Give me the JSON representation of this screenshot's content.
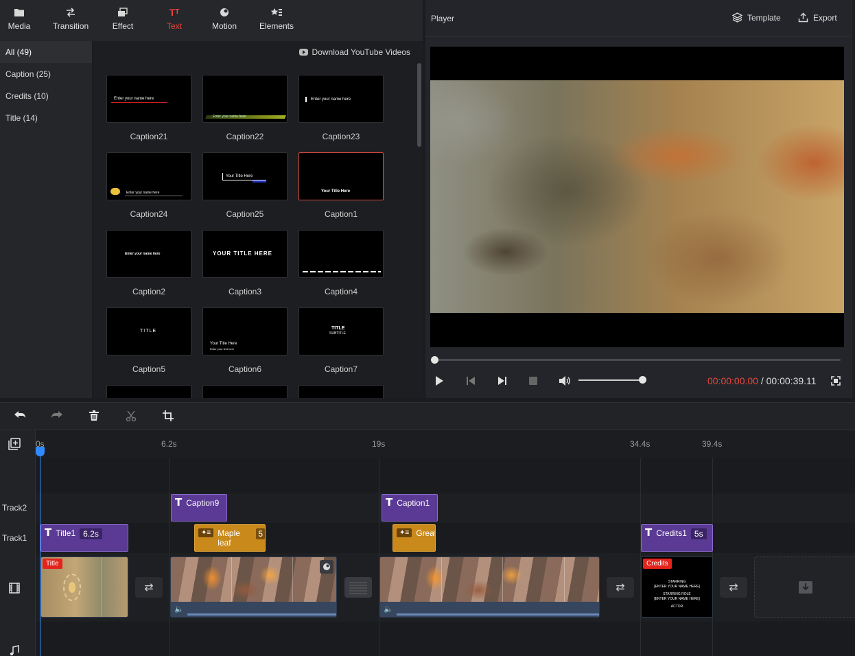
{
  "toolbar": {
    "tools": [
      {
        "label": "Media",
        "icon": "folder-icon"
      },
      {
        "label": "Transition",
        "icon": "transition-icon"
      },
      {
        "label": "Effect",
        "icon": "effect-icon"
      },
      {
        "label": "Text",
        "icon": "text-icon",
        "active": true
      },
      {
        "label": "Motion",
        "icon": "motion-icon"
      },
      {
        "label": "Elements",
        "icon": "elements-icon"
      }
    ],
    "active_color": "#f0443a"
  },
  "categories": [
    {
      "label": "All (49)",
      "active": true
    },
    {
      "label": "Caption (25)"
    },
    {
      "label": "Credits (10)"
    },
    {
      "label": "Title (14)"
    }
  ],
  "library": {
    "download_label": "Download YouTube Videos",
    "items": [
      {
        "name": "Caption21",
        "preview": "Enter your name here"
      },
      {
        "name": "Caption22",
        "preview": "Enter your name here"
      },
      {
        "name": "Caption23",
        "preview": "Enter your name here"
      },
      {
        "name": "Caption24",
        "preview": "Enter your name here"
      },
      {
        "name": "Caption25",
        "preview": "Your Title Here"
      },
      {
        "name": "Caption1",
        "preview": "Your  Title Here",
        "selected": true
      },
      {
        "name": "Caption2",
        "preview": "Enter your name here"
      },
      {
        "name": "Caption3",
        "preview": "YOUR TITLE HERE"
      },
      {
        "name": "Caption4",
        "preview": ""
      },
      {
        "name": "Caption5",
        "preview": "TITLE"
      },
      {
        "name": "Caption6",
        "preview": "Your  Title Here",
        "preview2": "Enter your text here"
      },
      {
        "name": "Caption7",
        "preview": "TITLE",
        "preview2": "SUBTITLE"
      }
    ]
  },
  "player": {
    "title": "Player",
    "template_label": "Template",
    "export_label": "Export",
    "current_time": "00:00:00.00",
    "separator": " / ",
    "total_time": "00:00:39.11",
    "volume_level": 1.0,
    "seek_position": 0.0
  },
  "timeline": {
    "tools": [
      "undo-icon",
      "redo-icon",
      "delete-icon",
      "cut-icon",
      "crop-icon"
    ],
    "ticks": [
      "0s",
      "6.2s",
      "19s",
      "34.4s",
      "39.4s"
    ],
    "tracks": {
      "track2": "Track2",
      "track1": "Track1"
    },
    "track2_clips": [
      {
        "label": "Caption9"
      },
      {
        "label": "Caption1"
      }
    ],
    "track1_clips": [
      {
        "label": "Title1",
        "duration": "6.2s",
        "kind": "text"
      },
      {
        "label": "Maple leaf",
        "duration": "5",
        "kind": "element"
      },
      {
        "label": "Great",
        "kind": "element"
      },
      {
        "label": "Credits1",
        "duration": "5s",
        "kind": "text"
      }
    ],
    "video_clips": [
      {
        "badge": "Title"
      },
      {},
      {},
      {
        "badge": "Credits"
      }
    ],
    "credits_preview": [
      "STARRING",
      "[ENTER YOUR NAME HERE]",
      "STARRING ROLE",
      "[ENTER YOUR NAME HERE]",
      "ACTOR"
    ]
  }
}
